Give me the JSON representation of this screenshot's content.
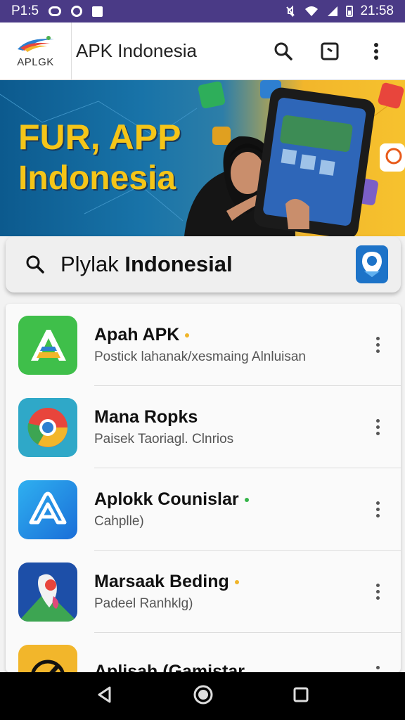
{
  "status_bar": {
    "carrier": "P1:5",
    "time": "21:58"
  },
  "app_bar": {
    "logo_text": "APLGK",
    "title": "APK Indonesia",
    "actions": [
      "search-icon",
      "screen-icon",
      "more-vert-icon"
    ]
  },
  "banner": {
    "line1": "FUR, APP",
    "line2": "Indonesia"
  },
  "search": {
    "prefix": "Plylak",
    "query": "Indonesial"
  },
  "apps": [
    {
      "name": "Apah APK",
      "desc": "Postick lahanak/xesmaing Alnluisan",
      "dot_color": "#f0b52a",
      "icon": "a-green-icon"
    },
    {
      "name": "Mana Ropks",
      "desc": "Paisek Taoriagl. Clnrios",
      "dot_color": "",
      "icon": "chrome-like-icon"
    },
    {
      "name": "Aplokk Counislar",
      "desc": "Cahplle)",
      "dot_color": "#35b449",
      "icon": "a-blue-icon"
    },
    {
      "name": "Marsaak Beding",
      "desc": "Padeel Ranhklg)",
      "dot_color": "#f0b52a",
      "icon": "maps-icon"
    },
    {
      "name": "Aplisah (Gamistar",
      "desc": "",
      "dot_color": "",
      "icon": "yellow-app-icon"
    }
  ],
  "colors": {
    "status_bar": "#4a3a86",
    "banner_text": "#f5c518",
    "search_pin": "#1d73c8"
  }
}
